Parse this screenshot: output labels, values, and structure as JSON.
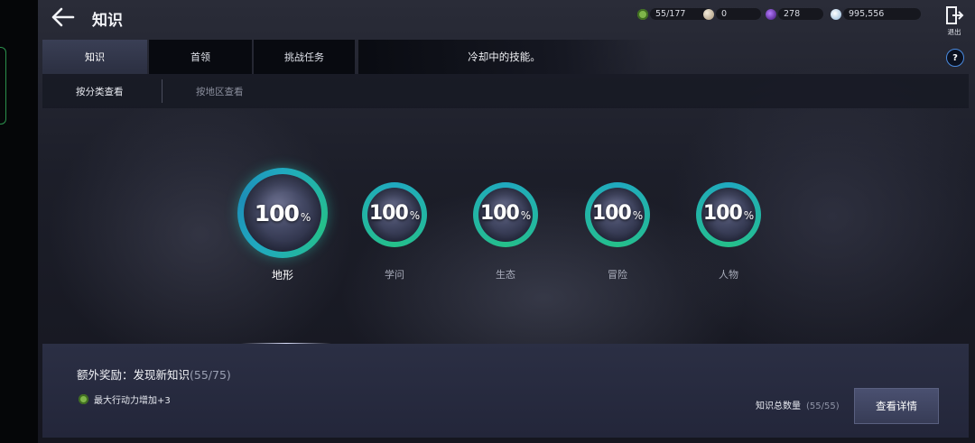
{
  "header": {
    "title": "知识",
    "exit_label": "退出"
  },
  "resources": [
    {
      "icon": "stamina-icon",
      "value": "55/177",
      "color": "#7fb64a"
    },
    {
      "icon": "coin-icon",
      "value": "0",
      "color": "#c9b89a"
    },
    {
      "icon": "purple-gem-icon",
      "value": "278",
      "color": "#7a3ec8"
    },
    {
      "icon": "crystal-icon",
      "value": "995,556",
      "color": "#cfe3f5"
    }
  ],
  "tabs": [
    {
      "label": "知识",
      "active": true
    },
    {
      "label": "首领",
      "active": false
    },
    {
      "label": "挑战任务",
      "active": false
    }
  ],
  "notice": "冷却中的技能。",
  "subtabs": [
    {
      "label": "按分类查看",
      "active": true
    },
    {
      "label": "按地区查看",
      "active": false
    }
  ],
  "categories": [
    {
      "name": "地形",
      "percent": "100",
      "unit": "%",
      "selected": true
    },
    {
      "name": "学问",
      "percent": "100",
      "unit": "%",
      "selected": false
    },
    {
      "name": "生态",
      "percent": "100",
      "unit": "%",
      "selected": false
    },
    {
      "name": "冒险",
      "percent": "100",
      "unit": "%",
      "selected": false
    },
    {
      "name": "人物",
      "percent": "100",
      "unit": "%",
      "selected": false
    }
  ],
  "bonus": {
    "label": "额外奖励：发现新知识",
    "count": "(55/75)",
    "reward": "最大行动力增加+3"
  },
  "total": {
    "label": "知识总数量",
    "count": "(55/55)"
  },
  "detail_button": "查看详情",
  "colors": {
    "ring_teal": "#1aa3b0",
    "ring_green": "#23b87a",
    "accent_blue": "#4a8be0"
  }
}
